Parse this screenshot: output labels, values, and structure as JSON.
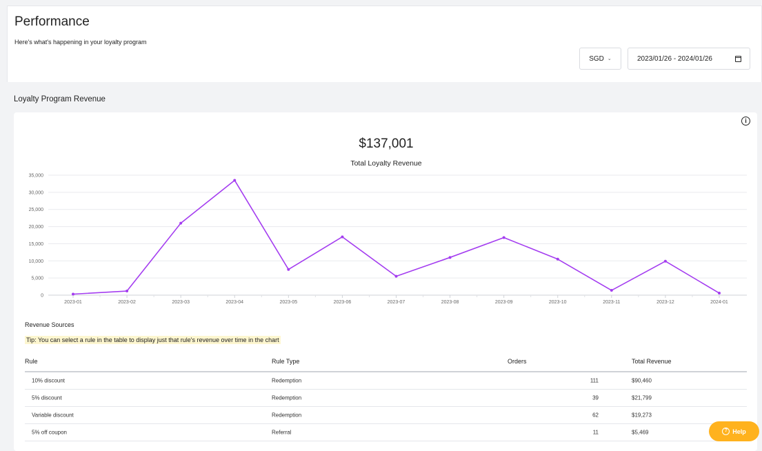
{
  "header": {
    "title": "Performance",
    "subtitle": "Here's what's happening in your loyalty program",
    "currency": "SGD",
    "date_range": "2023/01/26 - 2024/01/26"
  },
  "revenue_section": {
    "title": "Loyalty Program Revenue",
    "total_value": "$137,001",
    "total_label": "Total Loyalty Revenue"
  },
  "chart_data": {
    "type": "line",
    "x": [
      "2023-01",
      "2023-02",
      "2023-03",
      "2023-04",
      "2023-05",
      "2023-06",
      "2023-07",
      "2023-08",
      "2023-09",
      "2023-10",
      "2023-11",
      "2023-12",
      "2024-01"
    ],
    "series": [
      {
        "values": [
          300,
          1200,
          21000,
          33500,
          7500,
          17000,
          5500,
          11000,
          16800,
          10500,
          1400,
          9900,
          600
        ]
      }
    ],
    "ylim": [
      0,
      35000
    ],
    "yticks": [
      "0",
      "5,000",
      "10,000",
      "15,000",
      "20,000",
      "25,000",
      "30,000",
      "35,000"
    ],
    "y_tick_values": [
      0,
      5000,
      10000,
      15000,
      20000,
      25000,
      30000,
      35000
    ],
    "grid": true,
    "color": "#a43df0"
  },
  "sources": {
    "title": "Revenue Sources",
    "tip": "Tip: You can select a rule in the table to display just that rule's revenue over time in the chart",
    "columns": [
      "Rule",
      "Rule Type",
      "Orders",
      "Total Revenue"
    ],
    "rows": [
      {
        "rule": "10% discount",
        "type": "Redemption",
        "orders": "111",
        "revenue": "$90,460"
      },
      {
        "rule": "5% discount",
        "type": "Redemption",
        "orders": "39",
        "revenue": "$21,799"
      },
      {
        "rule": "Variable discount",
        "type": "Redemption",
        "orders": "62",
        "revenue": "$19,273"
      },
      {
        "rule": "5% off coupon",
        "type": "Referral",
        "orders": "11",
        "revenue": "$5,469"
      }
    ]
  },
  "help": {
    "label": "Help",
    "icon_glyph": "?"
  },
  "icons": {
    "info_glyph": "i",
    "chevron_glyph": "⌄"
  }
}
